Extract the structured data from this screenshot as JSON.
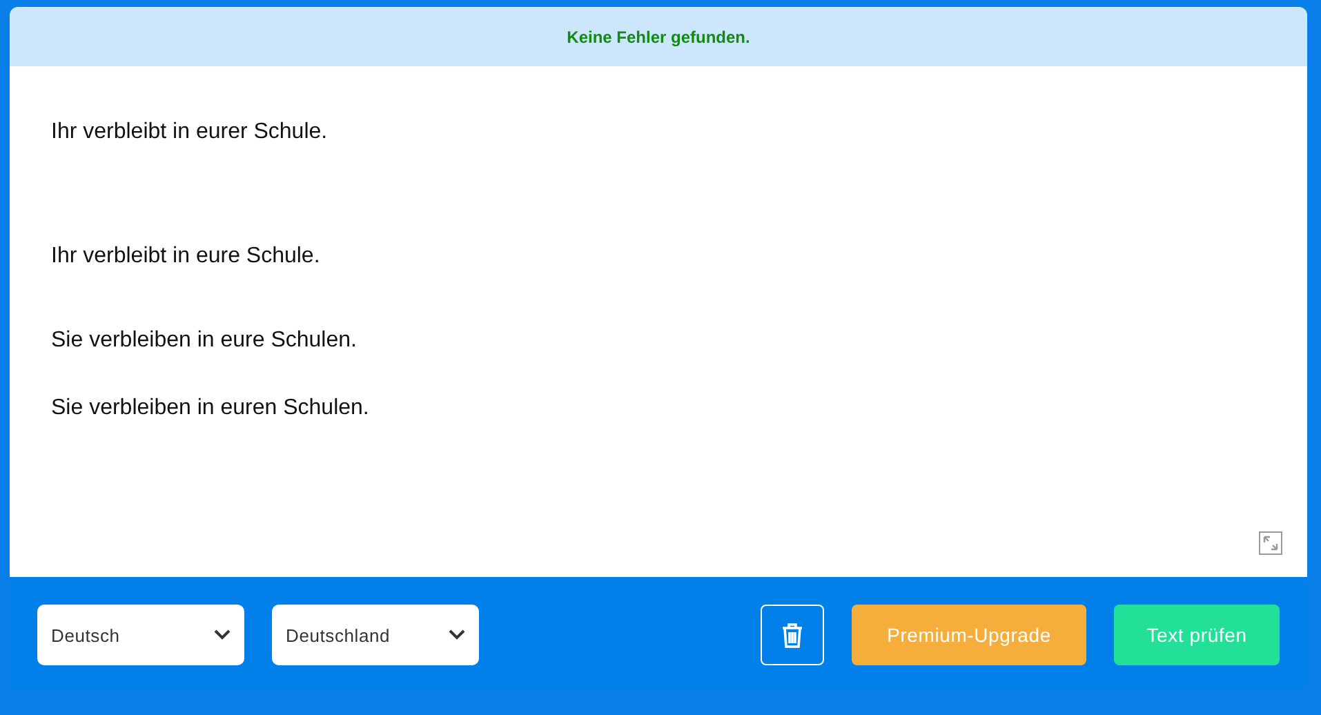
{
  "status": {
    "message": "Keine Fehler gefunden."
  },
  "editor": {
    "lines": [
      "Ihr verbleibt in eurer Schule.",
      "Ihr verbleibt in eure Schule.",
      "Sie verbleiben in eure Schulen.",
      "Sie verbleiben in euren Schulen."
    ]
  },
  "toolbar": {
    "language": "Deutsch",
    "region": "Deutschland",
    "buttons": [
      {
        "kind": "premium",
        "label": "Premium-Upgrade"
      },
      {
        "kind": "check",
        "label": "Text prüfen"
      }
    ]
  }
}
